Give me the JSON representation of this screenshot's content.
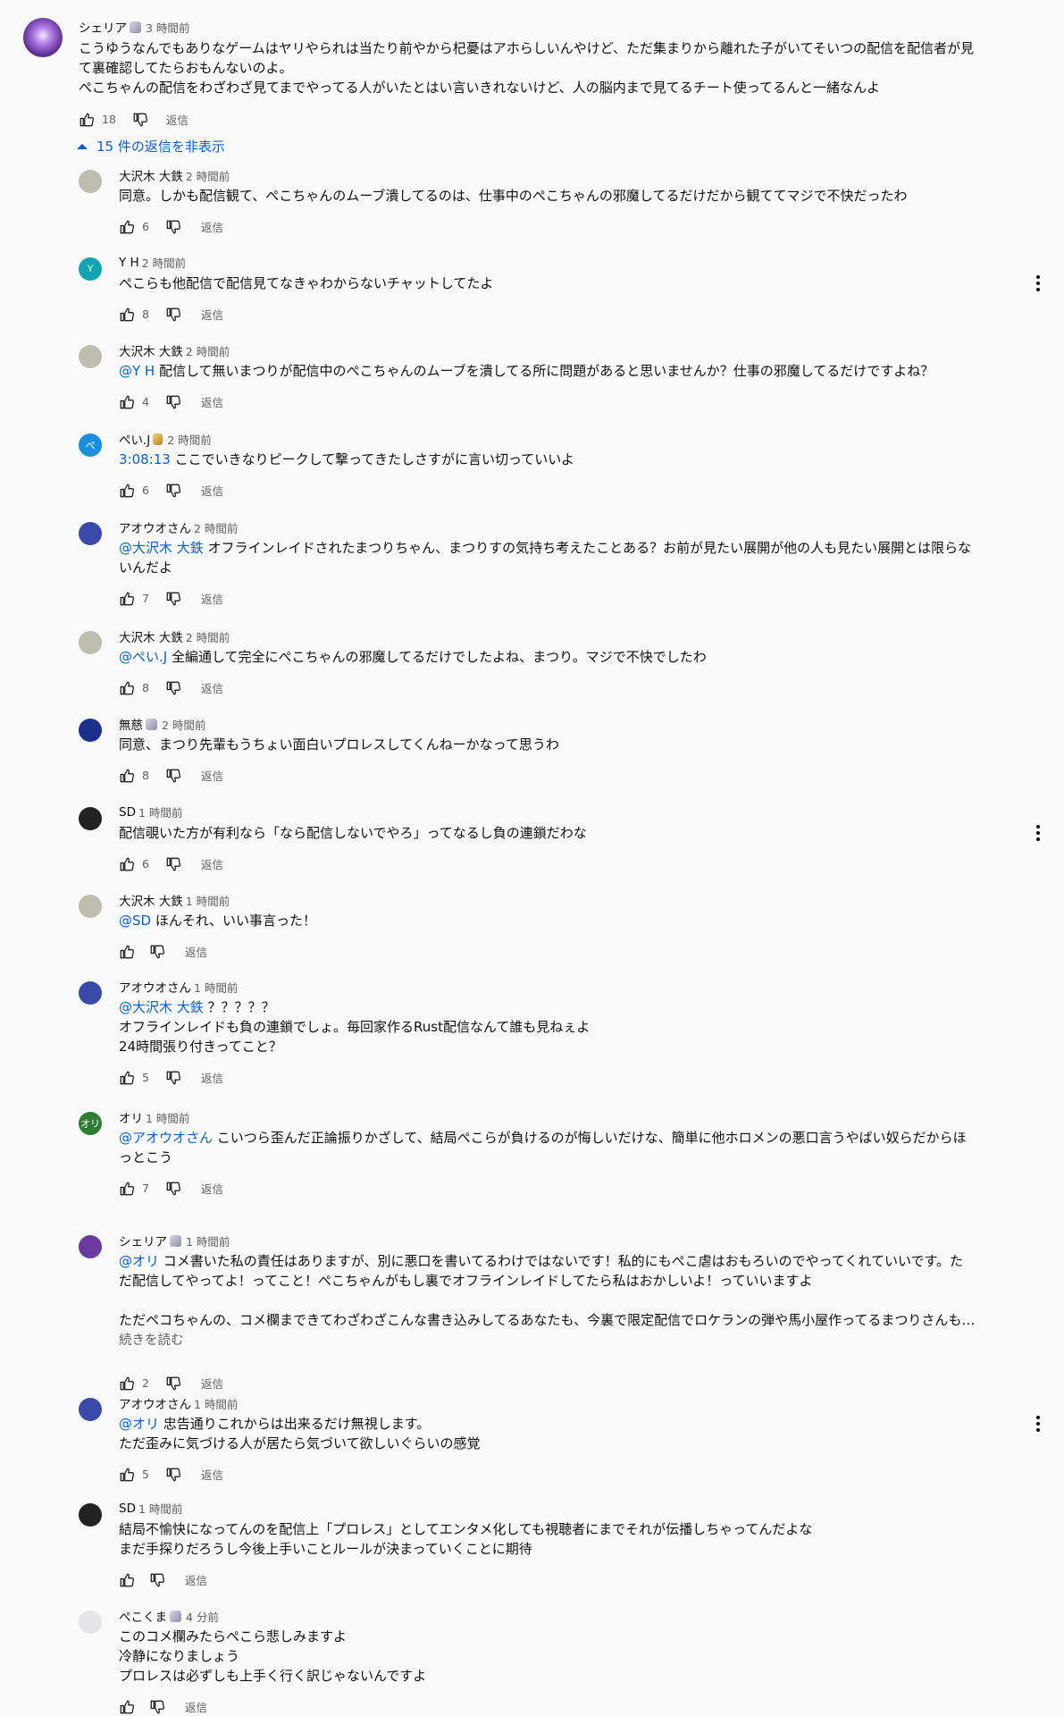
{
  "labels": {
    "reply": "返信",
    "read_more": "続きを読む"
  },
  "top": {
    "author": "シェリア",
    "badge": true,
    "time": "3 時間前",
    "lines": [
      "こうゆうなんでもありなゲームはヤリやられは当たり前やから杞憂はアホらしいんやけど、ただ集まりから離れた子がいてそいつの配信を配信者が見",
      "て裏確認してたらおもんないのよ。",
      "ぺこちゃんの配信をわざわざ見てまでやってる人がいたとはい言いきれないけど、人の脳内まで見てるチート使ってるんと一緒なんよ"
    ],
    "likes": "18"
  },
  "toggle_label": "15 件の返信を非表示",
  "replies": [
    {
      "author": "大沢木 大鉄",
      "time": "2 時間前",
      "avatar_color": "#bdbdb0",
      "lines": [
        [
          {
            "t": "同意。しかも配信観て、ぺこちゃんのムーブ潰してるのは、仕事中のぺこちゃんの邪魔してるだけだから観ててマジで不快だったわ"
          }
        ]
      ],
      "likes": "6"
    },
    {
      "author": "Y H",
      "time": "2 時間前",
      "avatar_color": "#12a4b3",
      "avatar_letter": "Y",
      "menu": true,
      "lines": [
        [
          {
            "t": "ぺこらも他配信で配信見てなきゃわからないチャットしてたよ"
          }
        ]
      ],
      "likes": "8"
    },
    {
      "author": "大沢木 大鉄",
      "time": "2 時間前",
      "avatar_color": "#bdbdb0",
      "lines": [
        [
          {
            "t": "@Y H",
            "m": 1
          },
          {
            "t": " 配信して無いまつりが配信中のぺこちゃんのムーブを潰してる所に問題があると思いませんか？仕事の邪魔してるだけですよね？"
          }
        ]
      ],
      "likes": "4"
    },
    {
      "author": "ぺい.J",
      "time": "2 時間前",
      "badge_gold": true,
      "avatar_color": "#1a8fe0",
      "avatar_letter": "ぺ",
      "lines": [
        [
          {
            "t": "3:08:13",
            "s": 1
          },
          {
            "t": " ここでいきなりピークして撃ってきたしさすがに言い切っていいよ"
          }
        ]
      ],
      "likes": "6"
    },
    {
      "author": "アオウオさん",
      "time": "2 時間前",
      "avatar_color": "#3a4aa8",
      "lines": [
        [
          {
            "t": "@大沢木 大鉄",
            "m": 1
          },
          {
            "t": " オフラインレイドされたまつりちゃん、まつりすの気持ち考えたことある？お前が見たい展開が他の人も見たい展開とは限らな"
          }
        ],
        [
          {
            "t": "いんだよ"
          }
        ]
      ],
      "likes": "7"
    },
    {
      "author": "大沢木 大鉄",
      "time": "2 時間前",
      "avatar_color": "#bdbdb0",
      "lines": [
        [
          {
            "t": "@ぺい.J",
            "m": 1
          },
          {
            "t": " 全編通して完全にぺこちゃんの邪魔してるだけでしたよね、まつり。マジで不快でしたわ"
          }
        ]
      ],
      "likes": "8"
    },
    {
      "author": "無慈",
      "time": "2 時間前",
      "badge": true,
      "avatar_color": "#1c2f8c",
      "lines": [
        [
          {
            "t": "同意、まつり先輩もうちょい面白いプロレスしてくんねーかなって思うわ"
          }
        ]
      ],
      "likes": "8"
    },
    {
      "author": "SD",
      "time": "1 時間前",
      "avatar_color": "#222222",
      "menu": true,
      "lines": [
        [
          {
            "t": "配信覗いた方が有利なら「なら配信しないでやろ」ってなるし負の連鎖だわな"
          }
        ]
      ],
      "likes": "6"
    },
    {
      "author": "大沢木 大鉄",
      "time": "1 時間前",
      "avatar_color": "#bdbdb0",
      "lines": [
        [
          {
            "t": "@SD",
            "m": 1
          },
          {
            "t": " ほんそれ、いい事言った！"
          }
        ]
      ],
      "likes": ""
    },
    {
      "author": "アオウオさん",
      "time": "1 時間前",
      "avatar_color": "#3a4aa8",
      "lines": [
        [
          {
            "t": "@大沢木 大鉄",
            "m": 1
          },
          {
            "t": " ？？？？？"
          }
        ],
        [
          {
            "t": "オフラインレイドも負の連鎖でしょ。毎回家作るRust配信なんて誰も見ねぇよ"
          }
        ],
        [
          {
            "t": "24時間張り付きってこと？"
          }
        ]
      ],
      "likes": "5"
    },
    {
      "author": "オリ",
      "time": "1 時間前",
      "avatar_color": "#2e7d32",
      "avatar_letter": "オリ",
      "lines": [
        [
          {
            "t": "@アオウオさん",
            "m": 1
          },
          {
            "t": " こいつら歪んだ正論振りかざして、結局ぺこらが負けるのが悔しいだけな、簡単に他ホロメンの悪口言うやばい奴らだからほ"
          }
        ],
        [
          {
            "t": "っとこう"
          }
        ]
      ],
      "likes": "7"
    },
    {
      "author": "シェリア",
      "time": "1 時間前",
      "badge": true,
      "avatar_color": "#6b3aa0",
      "lines": [
        [
          {
            "t": "@オリ",
            "m": 1
          },
          {
            "t": " コメ書いた私の責任はありますが、別に悪口を書いてるわけではないです！私的にもぺこ虐はおもろいのでやってくれていいです。た"
          }
        ],
        [
          {
            "t": "だ配信してやってよ！ってこと！ぺこちゃんがもし裏でオフラインレイドしてたら私はおかしいよ！っていいますよ"
          }
        ],
        [
          {
            "t": ""
          }
        ],
        [
          {
            "t": "ただペコちゃんの、コメ欄まできてわざわざこんな書き込みしてるあなたも、今裏で限定配信でロケランの弾や馬小屋作ってるまつりさんも…"
          }
        ]
      ],
      "read_more": true,
      "likes": "2"
    },
    {
      "author": "アオウオさん",
      "time": "1 時間前",
      "avatar_color": "#3a4aa8",
      "menu": true,
      "lines": [
        [
          {
            "t": "@オリ",
            "m": 1
          },
          {
            "t": " 忠告通りこれからは出来るだけ無視します。"
          }
        ],
        [
          {
            "t": "ただ歪みに気づける人が居たら気づいて欲しいぐらいの感覚"
          }
        ]
      ],
      "likes": "5"
    },
    {
      "author": "SD",
      "time": "1 時間前",
      "avatar_color": "#222222",
      "lines": [
        [
          {
            "t": "結局不愉快になってんのを配信上「プロレス」としてエンタメ化しても視聴者にまでそれが伝播しちゃってんだよな"
          }
        ],
        [
          {
            "t": "まだ手探りだろうし今後上手いことルールが決まっていくことに期待"
          }
        ]
      ],
      "likes": ""
    },
    {
      "author": "ぺこくま",
      "time": "4 分前",
      "badge": true,
      "avatar_color": "#e4e4ea",
      "lines": [
        [
          {
            "t": "このコメ欄みたらぺこら悲しみますよ"
          }
        ],
        [
          {
            "t": "冷静になりましょう"
          }
        ],
        [
          {
            "t": "プロレスは必ずしも上手く行く訳じゃないんですよ"
          }
        ]
      ],
      "likes": ""
    }
  ]
}
